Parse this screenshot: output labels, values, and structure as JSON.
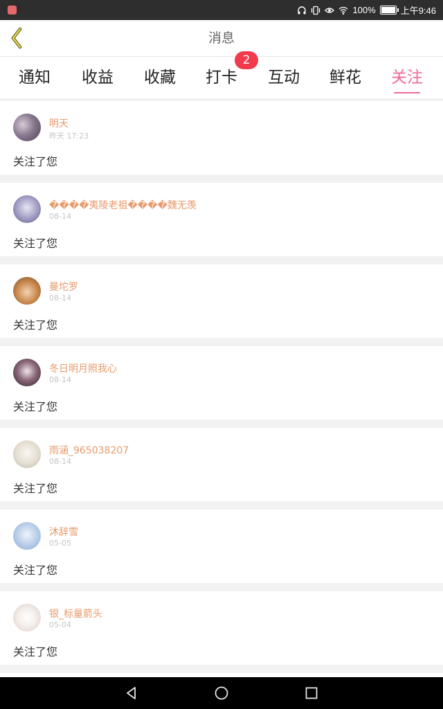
{
  "status_bar": {
    "battery": "100%",
    "time": "上午9:46"
  },
  "header": {
    "title": "消息"
  },
  "tabs": [
    {
      "label": "通知"
    },
    {
      "label": "收益"
    },
    {
      "label": "收藏"
    },
    {
      "label": "打卡",
      "badge": "2"
    },
    {
      "label": "互动"
    },
    {
      "label": "鲜花"
    },
    {
      "label": "关注",
      "active": true
    }
  ],
  "messages": [
    {
      "name": "明天",
      "date": "昨天 17:23",
      "action": "关注了您"
    },
    {
      "name": "����夷陵老祖����魏无羡",
      "date": "08-14",
      "action": "关注了您"
    },
    {
      "name": "曼坨罗",
      "date": "08-14",
      "action": "关注了您"
    },
    {
      "name": "冬日明月照我心",
      "date": "08-14",
      "action": "关注了您"
    },
    {
      "name": "雨涵_965038207",
      "date": "08-14",
      "action": "关注了您"
    },
    {
      "name": "沐辞雪",
      "date": "05-05",
      "action": "关注了您"
    },
    {
      "name": "银_标量箭头",
      "date": "05-04",
      "action": "关注了您"
    }
  ],
  "colors": {
    "accent": "#f0689a",
    "username": "#e79a6b",
    "badge": "#f23a4c"
  }
}
